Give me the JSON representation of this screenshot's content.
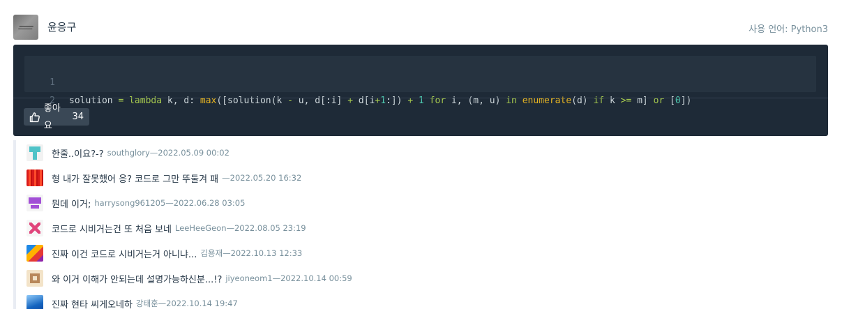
{
  "header": {
    "username": "윤응구",
    "language": "사용 언어: Python3"
  },
  "code": {
    "line_numbers": [
      "1",
      "2"
    ]
  },
  "like": {
    "label": "좋아요",
    "count": "34"
  },
  "comments": [
    {
      "text": "한줄..이요?-?",
      "meta": "southglory—2022.05.09 00:02"
    },
    {
      "text": "형 내가 잘못했어 응? 코드로 그만 뚜둘겨 패",
      "meta": "—2022.05.20 16:32"
    },
    {
      "text": "뭔데 이거;",
      "meta": "harrysong961205—2022.06.28 03:05"
    },
    {
      "text": "코드로 시비거는건 또 처음 보네",
      "meta": "LeeHeeGeon—2022.08.05 23:19"
    },
    {
      "text": "진짜 이건 코드로 시비거는거 아니냐...",
      "meta": "김용재—2022.10.13 12:33"
    },
    {
      "text": "와 이거 이해가 안되는데 설명가능하신분...!?",
      "meta": "jiyeoneom1—2022.10.14 00:59"
    },
    {
      "text": "진짜 현타 씨게오네하",
      "meta": "강태훈—2022.10.14 19:47"
    }
  ]
}
